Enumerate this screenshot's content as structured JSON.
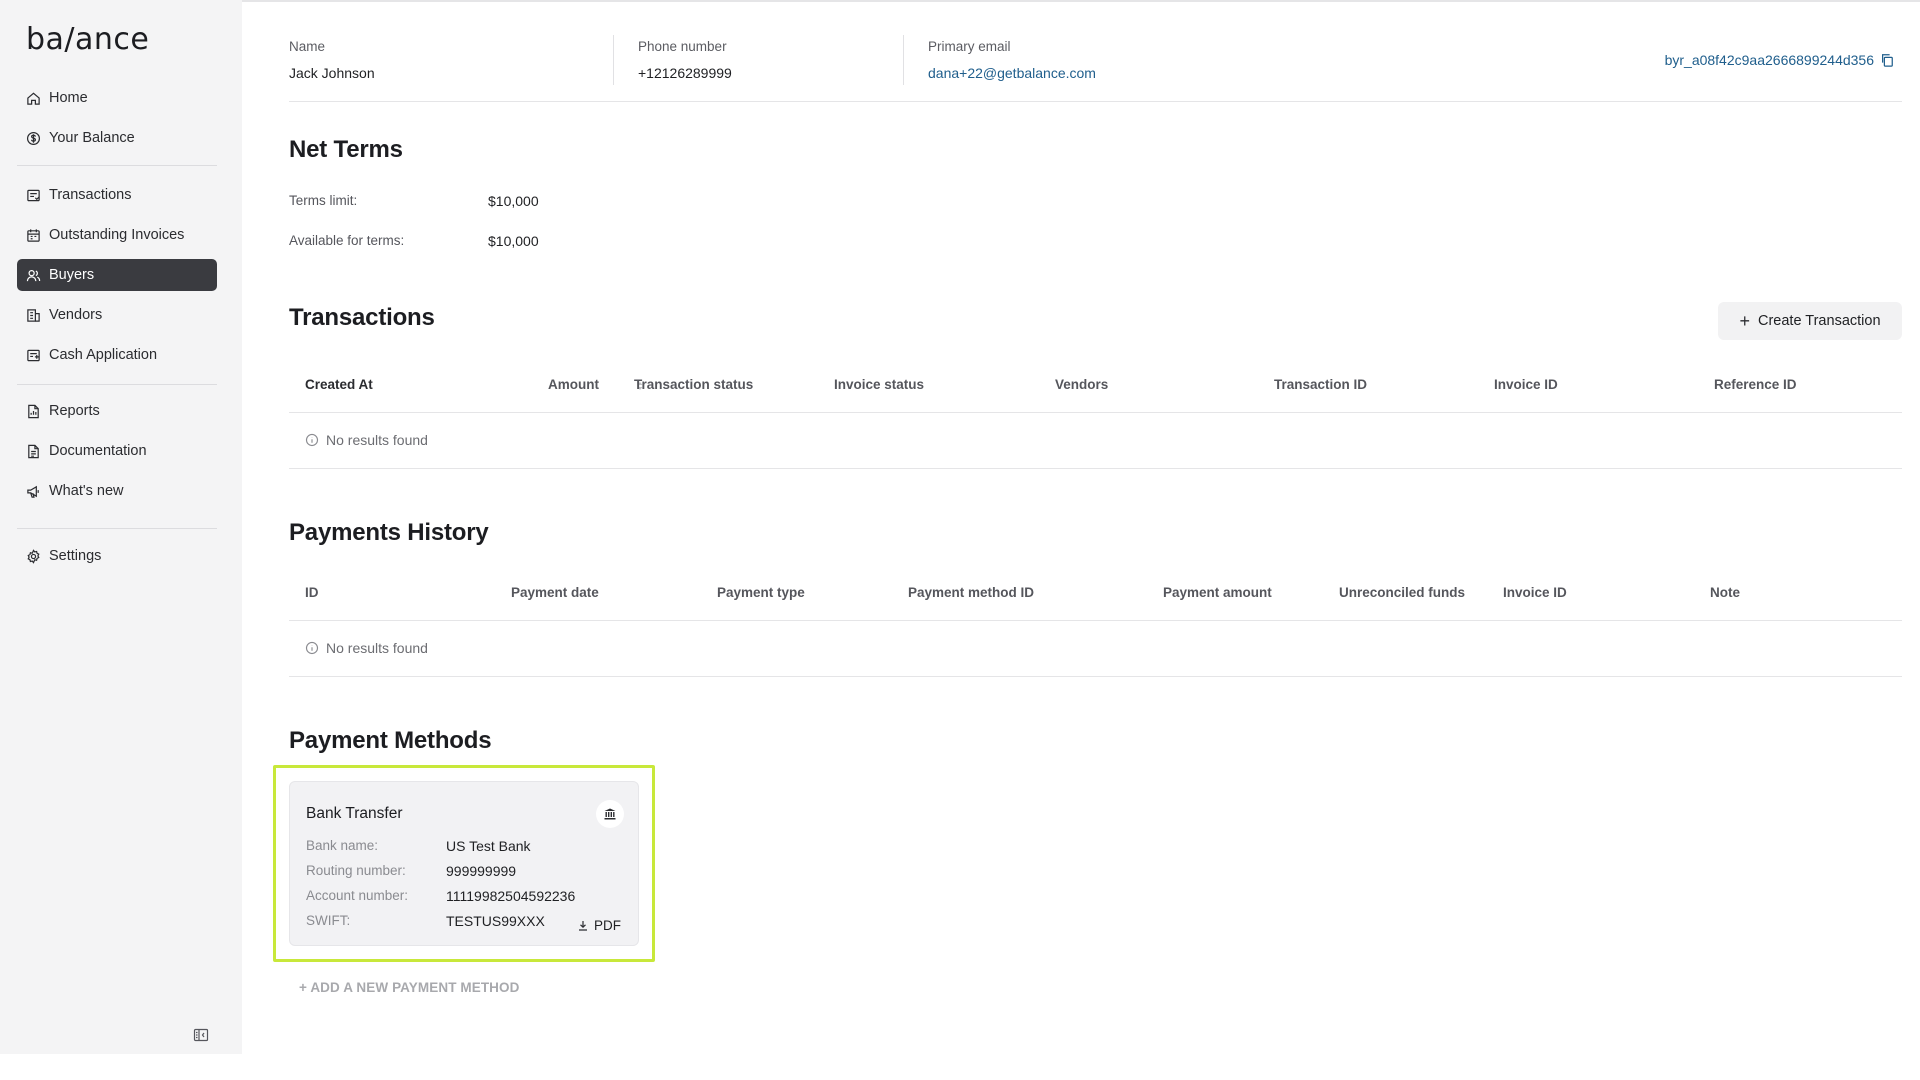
{
  "app": {
    "logo": "ba/ance"
  },
  "sidebar": {
    "items": [
      {
        "label": "Home",
        "icon": "home-icon"
      },
      {
        "label": "Your Balance",
        "icon": "dollar-circle-icon"
      },
      {
        "label": "Transactions",
        "icon": "transactions-icon"
      },
      {
        "label": "Outstanding Invoices",
        "icon": "calendar-icon"
      },
      {
        "label": "Buyers",
        "icon": "users-icon",
        "active": true
      },
      {
        "label": "Vendors",
        "icon": "building-icon"
      },
      {
        "label": "Cash Application",
        "icon": "cash-application-icon"
      },
      {
        "label": "Reports",
        "icon": "report-icon"
      },
      {
        "label": "Documentation",
        "icon": "document-icon"
      },
      {
        "label": "What's new",
        "icon": "megaphone-icon"
      },
      {
        "label": "Settings",
        "icon": "gear-icon"
      }
    ]
  },
  "buyer": {
    "name_label": "Name",
    "name": "Jack Johnson",
    "phone_label": "Phone number",
    "phone": "+12126289999",
    "email_label": "Primary email",
    "email": "dana+22@getbalance.com",
    "id": "byr_a08f42c9aa2666899244d356"
  },
  "net_terms": {
    "title": "Net Terms",
    "limit_label": "Terms limit:",
    "limit_value": "$10,000",
    "available_label": "Available for terms:",
    "available_value": "$10,000"
  },
  "transactions": {
    "title": "Transactions",
    "create_label": "Create Transaction",
    "columns": [
      "Created At",
      "Amount",
      "Transaction status",
      "Invoice status",
      "Vendors",
      "Transaction ID",
      "Invoice ID",
      "Reference ID"
    ],
    "empty": "No results found"
  },
  "payments_history": {
    "title": "Payments History",
    "columns": [
      "ID",
      "Payment date",
      "Payment type",
      "Payment method ID",
      "Payment amount",
      "Unreconciled funds",
      "Invoice ID",
      "Note"
    ],
    "empty": "No results found"
  },
  "payment_methods": {
    "title": "Payment Methods",
    "card": {
      "title": "Bank Transfer",
      "bank_name_label": "Bank name:",
      "bank_name": "US Test Bank",
      "routing_label": "Routing number:",
      "routing": "999999999",
      "account_label": "Account number:",
      "account": "11119982504592236",
      "swift_label": "SWIFT:",
      "swift": "TESTUS99XXX",
      "pdf_label": "PDF"
    },
    "add_label": "+ ADD A NEW PAYMENT METHOD"
  },
  "colors": {
    "active_nav": "#3a3b40",
    "link": "#1f5e8c",
    "highlight": "#c8e83a"
  }
}
